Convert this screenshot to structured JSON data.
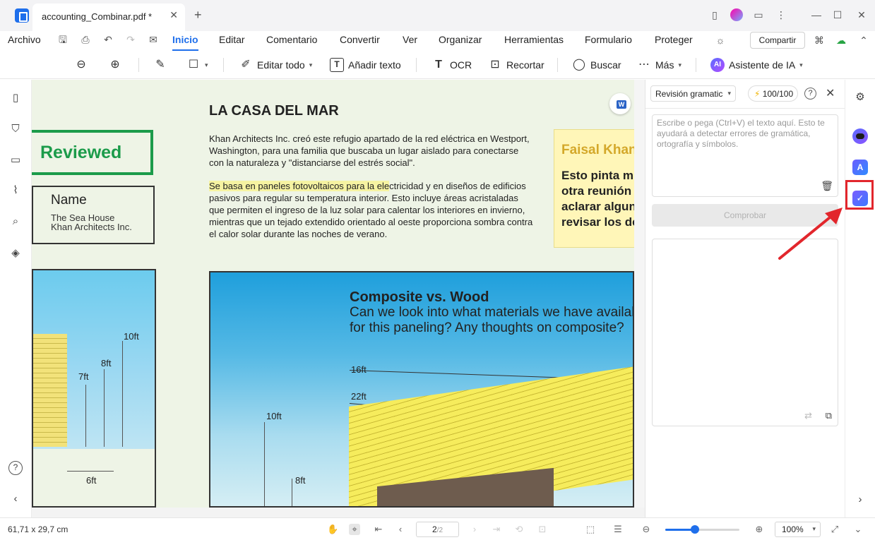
{
  "titlebar": {
    "tab_title": "accounting_Combinar.pdf *",
    "close_glyph": "✕",
    "new_tab_glyph": "+"
  },
  "menu": {
    "items": [
      "Archivo",
      "Inicio",
      "Editar",
      "Comentario",
      "Convertir",
      "Ver",
      "Organizar",
      "Herramientas",
      "Formulario",
      "Proteger"
    ],
    "active": "Inicio",
    "share_label": "Compartir"
  },
  "toolbar": {
    "edit_all": "Editar todo",
    "add_text": "Añadir texto",
    "ocr": "OCR",
    "crop": "Recortar",
    "search": "Buscar",
    "more": "Más",
    "ai_badge": "AI",
    "ai_assistant": "Asistente de IA"
  },
  "document": {
    "stamp_text": "Reviewed",
    "name_box": {
      "title": "Name",
      "line1": "The Sea House",
      "line2": "Khan Architects Inc."
    },
    "left_figure_dims": [
      "10ft",
      "8ft",
      "7ft",
      "6ft"
    ],
    "heading": "LA CASA DEL MAR",
    "para1": "Khan Architects Inc. creó este refugio apartado de la red eléctrica en Westport, Washington, para una familia que buscaba un lugar aislado para conectarse con la naturaleza y \"distanciarse del estrés social\".",
    "para2_highlight": "Se basa en paneles fotovoltaicos para la ele",
    "para2_rest": "ctricidad y en diseños de edificios pasivos para regular su temperatura interior. Esto incluye áreas acristaladas que permiten el ingreso de la luz solar para calentar los interiores en invierno, mientras que un tejado extendido orientado al oeste proporciona sombra contra el calor solar durante las noches de verano.",
    "note": {
      "author": "Faisal Khan",
      "body": "Esto pinta muy bien\notra reunión para\naclarar algunos\nrevisar los detalles"
    },
    "figure": {
      "title": "Composite vs. Wood",
      "subtitle": "Can we look into what materials we have available\nfor this paneling? Any thoughts on composite?",
      "dims": [
        "16ft",
        "22ft",
        "10ft",
        "8ft"
      ]
    }
  },
  "panel": {
    "mode": "Revisión gramatical",
    "credits": "100/100",
    "help_glyph": "?",
    "close_glyph": "✕",
    "input_placeholder": "Escribe o pega (Ctrl+V) el texto aquí. Esto te ayudará a detectar errores de gramática, ortografía y símbolos.",
    "check_button": "Comprobar"
  },
  "rail": {
    "translate_glyph": "A",
    "grammar_glyph": "✓",
    "annotation_color": "#e2262c"
  },
  "status": {
    "dimensions": "61,71 x 29,7 cm",
    "page_current": "2",
    "page_total": "/2",
    "zoom": "100%",
    "zoom_fraction": 0.4
  },
  "colors": {
    "accent": "#1f6feb",
    "stamp_green": "#1b9b4a",
    "highlight_yellow": "#f6f3a2"
  }
}
